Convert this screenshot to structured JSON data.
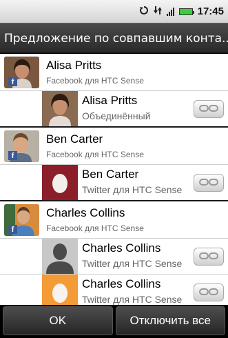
{
  "status_bar": {
    "time": "17:45",
    "icons": [
      "sync-icon",
      "data-transfer-icon",
      "signal-icon",
      "battery-icon"
    ]
  },
  "title": "Предложение по совпавшим конта...",
  "groups": [
    {
      "name": "Alisa Pritts",
      "source": "Facebook для HTC Sense",
      "badge": "f",
      "matches": [
        {
          "name": "Alisa Pritts",
          "source": "Объединённый"
        }
      ]
    },
    {
      "name": "Ben Carter",
      "source": "Facebook для HTC Sense",
      "badge": "f",
      "matches": [
        {
          "name": "Ben Carter",
          "source": "Twitter для HTC Sense"
        }
      ]
    },
    {
      "name": "Charles Collins",
      "source": "Facebook для HTC Sense",
      "badge": "f",
      "matches": [
        {
          "name": "Charles Collins",
          "source": "Twitter для HTC Sense"
        },
        {
          "name": "Charles Collins",
          "source": "Twitter для HTC Sense"
        }
      ]
    }
  ],
  "buttons": {
    "ok": "OK",
    "disable_all": "Отключить все"
  },
  "colors": {
    "facebook": "#3b5998",
    "egg_red": "#8c1e2a",
    "egg_orange": "#f29b37",
    "battery": "#3ecb3e"
  }
}
